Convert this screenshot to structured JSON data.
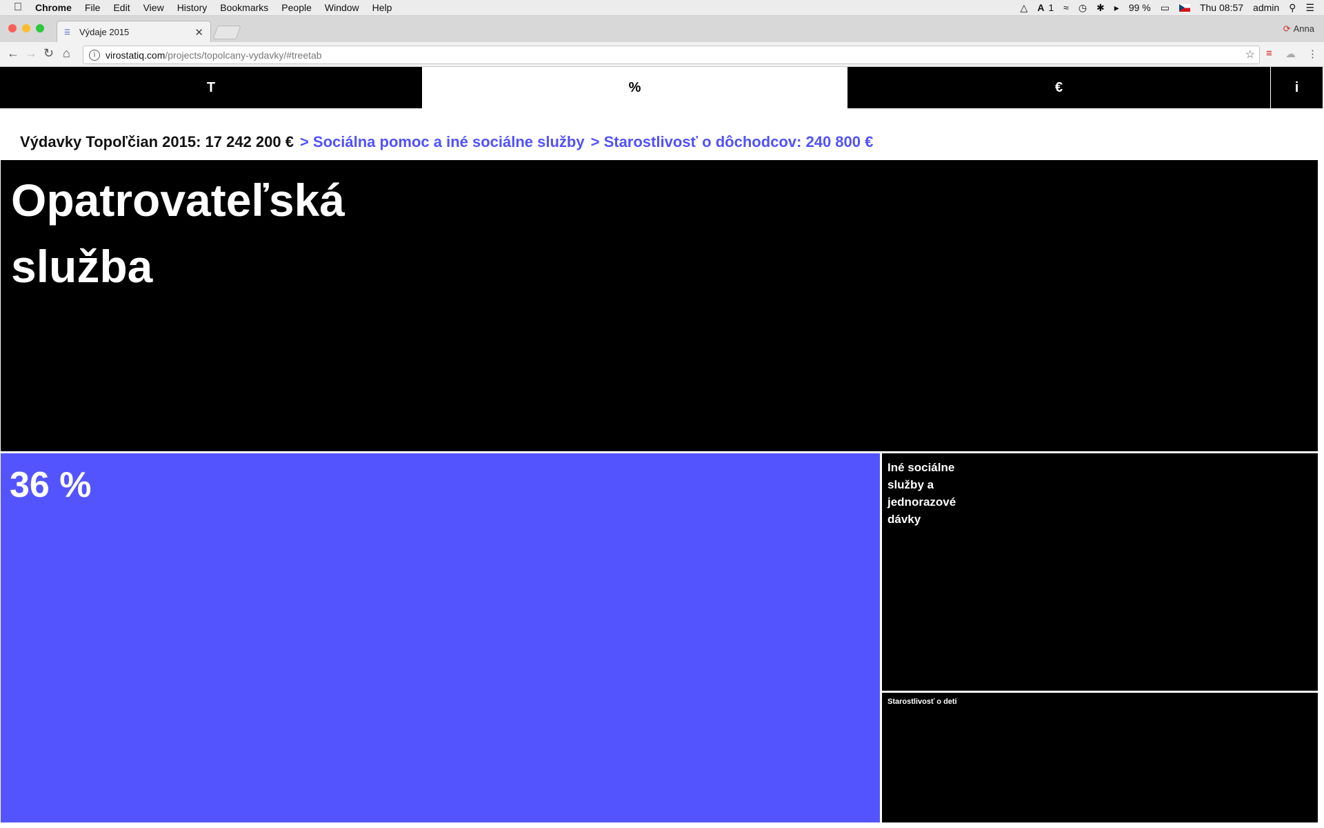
{
  "menubar": {
    "app_name": "Chrome",
    "items": [
      "File",
      "Edit",
      "View",
      "History",
      "Bookmarks",
      "People",
      "Window",
      "Help"
    ],
    "status": {
      "adobe_count": "1",
      "battery": "99 %",
      "clock": "Thu 08:57",
      "user": "admin"
    }
  },
  "browser": {
    "tab_title": "Výdaje 2015",
    "profile_name": "Anna",
    "url_host": "virostatiq.com",
    "url_path": "/projects/topolcany-vydavky/#treetab"
  },
  "page": {
    "nav_tabs": [
      {
        "label": "T",
        "active": false
      },
      {
        "label": "%",
        "active": true
      },
      {
        "label": "€",
        "active": false
      },
      {
        "label": "i",
        "active": false
      }
    ],
    "breadcrumb": {
      "root": "Výdavky Topoľčian 2015: 17 242 200 €",
      "crumbs": [
        "> Sociálna pomoc a iné sociálne služby",
        "> Starostlivosť o dôchodcov: 240 800 €"
      ]
    },
    "treemap": {
      "cells": [
        {
          "label": "Opatrovateľská služba",
          "color": "#000000"
        },
        {
          "label": "36 %",
          "color": "#5454ff"
        },
        {
          "label": "Iné sociálne služby a jednorazové dávky",
          "color": "#000000"
        },
        {
          "label": "Starostlivosť o deti",
          "color": "#000000"
        }
      ]
    }
  },
  "colors": {
    "accent": "#5454ff",
    "tab_active_bg": "#ffffff",
    "tab_inactive_bg": "#000000"
  }
}
